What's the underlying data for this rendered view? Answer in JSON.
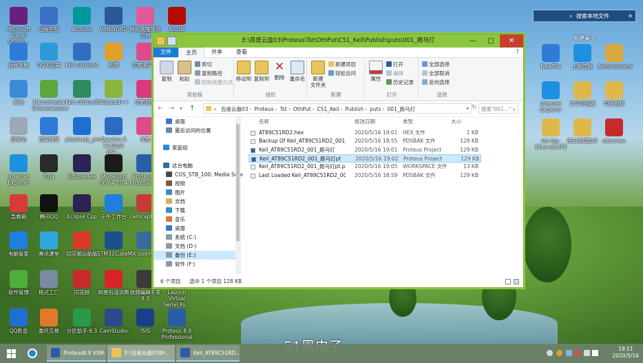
{
  "desktop_left_icons": [
    {
      "label": "Microsoft Visual Studio...",
      "icon": "visual-studio-icon",
      "color": "#68217a"
    },
    {
      "label": "远程控制",
      "icon": "remote-control-icon",
      "color": "#3a6fc4"
    },
    {
      "label": "Arduino",
      "icon": "arduino-icon",
      "color": "#00979c"
    },
    {
      "label": "WINWORD",
      "icon": "word-icon",
      "color": "#2b579a"
    },
    {
      "label": "网络唤醒服务工具",
      "icon": "wake-tool-icon",
      "color": "#e05a9a"
    },
    {
      "label": "Adobe Acro...",
      "icon": "acrobat-icon",
      "color": "#b30b00"
    },
    {
      "label": "远程电脑",
      "icon": "remote-pc-icon",
      "color": "#2f7bd6"
    },
    {
      "label": "QQ浏览器",
      "icon": "qq-browser-icon",
      "color": "#2e9ad9"
    },
    {
      "label": "Keil uVision4",
      "icon": "keil4-icon",
      "color": "#2f6fbf"
    },
    {
      "label": "画图",
      "icon": "paint-icon",
      "color": "#e0a02a"
    },
    {
      "label": "优酷客户端",
      "icon": "youku-icon",
      "color": "#e04a8a"
    },
    {
      "label": "网络",
      "icon": "network-icon",
      "color": "#3b8ad8"
    },
    {
      "label": "Macromedia Dreamweaver",
      "icon": "dreamweaver-icon",
      "color": "#5ca63c"
    },
    {
      "label": "Keil uVision5",
      "icon": "keil5-icon",
      "color": "#2f8a5f"
    },
    {
      "label": "Notepad++",
      "icon": "notepadpp-icon",
      "color": "#8ab43c"
    },
    {
      "label": "优酷视频",
      "icon": "youku-video-icon",
      "color": "#d83a7a"
    },
    {
      "label": "回收站",
      "icon": "recycle-bin-icon",
      "color": "#9aa8b8"
    },
    {
      "label": "百度网盘",
      "icon": "baidu-pan-icon",
      "color": "#2f7bd6"
    },
    {
      "label": "phpstudy_pro",
      "icon": "phpstudy-icon",
      "color": "#1e6fd0"
    },
    {
      "label": "Quartus II 13.0sp1 (64...",
      "icon": "quartus-icon",
      "color": "#2a6cc4"
    },
    {
      "label": "优酷",
      "icon": "youku2-icon",
      "color": "#e04a8a"
    },
    {
      "label": "Internet Explorer",
      "icon": "ie-icon",
      "color": "#1e90e0"
    },
    {
      "label": "Tina",
      "icon": "tina-icon",
      "color": "#2a2a2a"
    },
    {
      "label": "Eclipse Jee",
      "icon": "eclipse-jee-icon",
      "color": "#2c2255"
    },
    {
      "label": "Modelsim SE-64 10.4",
      "icon": "modelsim-icon",
      "color": "#1a1a1a"
    },
    {
      "label": "Proteus 8 Professional",
      "icon": "proteus-icon",
      "color": "#2a5ca8"
    },
    {
      "label": "急救箱",
      "icon": "rescue-icon",
      "color": "#d83a3a"
    },
    {
      "label": "腾讯QQ",
      "icon": "qq-icon",
      "color": "#111111"
    },
    {
      "label": "Eclipse Cpp",
      "icon": "eclipse-cpp-icon",
      "color": "#2c2255"
    },
    {
      "label": "千牛工作台",
      "icon": "qianniu-icon",
      "color": "#1e7fe0"
    },
    {
      "label": "camcapture",
      "icon": "camcapture-icon",
      "color": "#c83a3a"
    },
    {
      "label": "电脑管家",
      "icon": "pc-manager-icon",
      "color": "#1e7fe0"
    },
    {
      "label": "腾讯课堂",
      "icon": "tencent-class-icon",
      "color": "#2fa8e0"
    },
    {
      "label": "同花顺远航版",
      "icon": "tonghuashun-icon",
      "color": "#d83a2a"
    },
    {
      "label": "STM32CubeMX",
      "icon": "stm32cube-icon",
      "color": "#1a4f8a"
    },
    {
      "label": "zoom",
      "icon": "zoom-icon",
      "color": "#3a6a9a"
    },
    {
      "label": "软件管理",
      "icon": "software-manager-icon",
      "color": "#4caf3a"
    },
    {
      "label": "格式工厂",
      "icon": "format-factory-icon",
      "color": "#7a8aa0"
    },
    {
      "label": "同花顺",
      "icon": "tonghuashun2-icon",
      "color": "#c82a2a"
    },
    {
      "label": "网易有道词典",
      "icon": "youdao-icon",
      "color": "#d8222a"
    },
    {
      "label": "视频编辑专家 9.3",
      "icon": "video-editor-icon",
      "color": "#3a3a3a"
    },
    {
      "label": "Launch Virtual Serial Po...",
      "icon": "virtual-serial-icon",
      "color": "#6a6a6a"
    },
    {
      "label": "QQ影音",
      "icon": "qq-player-icon",
      "color": "#1e6fd0"
    },
    {
      "label": "委托交易",
      "icon": "trade-icon",
      "color": "#e07a2a"
    },
    {
      "label": "分区助手 6.3",
      "icon": "partition-icon",
      "color": "#2a9a4a"
    },
    {
      "label": "CamStudio",
      "icon": "camstudio-icon",
      "color": "#2a4a8a"
    },
    {
      "label": "ISIS",
      "icon": "isis-icon",
      "color": "#1a3f8a"
    },
    {
      "label": "Proteus 8.9 Professional",
      "icon": "proteus89-icon",
      "color": "#2a5ca8"
    }
  ],
  "desktop_right_icons": [
    {
      "label": "NewFile",
      "icon": "newfile-icon",
      "color": "#2f7bd6"
    },
    {
      "label": "上网导航",
      "icon": "ie-nav-icon",
      "color": "#1e90e0"
    },
    {
      "label": "Administrator",
      "icon": "user-folder-icon",
      "color": "#d9a83a"
    },
    {
      "label": "Internet Explorer",
      "icon": "ie2-icon",
      "color": "#1e90e0"
    },
    {
      "label": "文字识别器",
      "icon": "ocr-folder-icon",
      "color": "#e0b84a"
    },
    {
      "label": "中间视频",
      "icon": "video-folder-icon",
      "color": "#e0b84a"
    },
    {
      "label": "stc-isp-15xx-v6.87E",
      "icon": "stc-folder-icon",
      "color": "#e0b84a"
    },
    {
      "label": "串口调试助手",
      "icon": "serial-folder-icon",
      "color": "#e0b84a"
    },
    {
      "label": "sdccman",
      "icon": "pdf-icon",
      "color": "#c82a2a"
    }
  ],
  "right_panel": {
    "search_label": "搜索本地文件",
    "title": "新建桌子"
  },
  "explorer": {
    "title": "E:\\百度云盘03\\Proteus\\Tst\\OthPut\\C51_Keil\\Publish\\puts\\001_跑马灯",
    "window_controls": {
      "minimize": "—",
      "maximize": "□",
      "close": "✕"
    },
    "tabs": [
      "文件",
      "主页",
      "共享",
      "查看"
    ],
    "help": "?",
    "ribbon": {
      "clipboard": {
        "label": "剪贴板",
        "copy": "复制",
        "paste": "粘贴",
        "cut": "剪切",
        "copy_path": "复制路径",
        "paste_shortcut": "粘贴快捷方式"
      },
      "organize": {
        "label": "组织",
        "move_to": "移动到",
        "copy_to": "复制到",
        "delete": "删除",
        "rename": "重命名"
      },
      "new": {
        "label": "新建",
        "new_folder": "新建\n文件夹",
        "new_item": "新建项目",
        "easy_access": "轻松访问"
      },
      "open": {
        "label": "打开",
        "properties": "属性",
        "open": "打开",
        "edit": "编辑",
        "history": "历史记录"
      },
      "select": {
        "label": "选择",
        "select_all": "全部选择",
        "select_none": "全部取消",
        "invert": "反向选择"
      }
    },
    "address": {
      "segments": [
        "百度云盘03",
        "Proteus",
        "Tst",
        "OthPut",
        "C51_Keil",
        "Publish",
        "puts",
        "001_跑马灯"
      ],
      "search_placeholder": "搜索\"001...\""
    },
    "nav": {
      "back": "←",
      "forward": "→",
      "up": "↑",
      "prefix": "«",
      "refresh": "↻"
    },
    "nav_items": [
      {
        "label": "桌面",
        "icon": "desktop-icon",
        "color": "#3a78c4"
      },
      {
        "label": "最近访问的位置",
        "icon": "recent-icon",
        "color": "#6a8aaa"
      },
      {
        "label": "家庭组",
        "icon": "homegroup-icon",
        "color": "#2a8ad8"
      },
      {
        "label": "这台电脑",
        "icon": "this-pc-icon",
        "color": "#3a6aa8"
      },
      {
        "label": "COS_STB_100: Media Serv",
        "icon": "media-server-icon",
        "color": "#4a4a4a"
      },
      {
        "label": "视频",
        "icon": "videos-folder-icon",
        "color": "#7a5a3a"
      },
      {
        "label": "图片",
        "icon": "pictures-folder-icon",
        "color": "#3a8ac8"
      },
      {
        "label": "文档",
        "icon": "documents-folder-icon",
        "color": "#d9b050"
      },
      {
        "label": "下载",
        "icon": "downloads-folder-icon",
        "color": "#3a8ac8"
      },
      {
        "label": "音乐",
        "icon": "music-folder-icon",
        "color": "#d97a3a"
      },
      {
        "label": "桌面",
        "icon": "desktop2-icon",
        "color": "#3a78c4"
      },
      {
        "label": "系统 (C:)",
        "icon": "drive-c-icon",
        "color": "#8a9aaa"
      },
      {
        "label": "文档 (D:)",
        "icon": "drive-d-icon",
        "color": "#8a9aaa"
      },
      {
        "label": "备份 (E:)",
        "icon": "drive-e-icon",
        "color": "#8a9aaa"
      },
      {
        "label": "软件 (F:)",
        "icon": "drive-f-icon",
        "color": "#8a9aaa"
      }
    ],
    "columns": {
      "name": "名称",
      "date": "修改日期",
      "type": "类型",
      "size": "大小"
    },
    "files": [
      {
        "name": "AT89C51RD2.hex",
        "date": "2020/5/16 19:01",
        "type": "HEX 文件",
        "size": "1 KB",
        "icon": "hex-file-icon"
      },
      {
        "name": "Backup Of Keil_AT89C51RD2_001_跑...",
        "date": "2020/5/16 18:55",
        "type": "PDSBAK 文件",
        "size": "128 KB",
        "icon": "bak-file-icon"
      },
      {
        "name": "Keil_AT89C51RD2_001_跑马灯",
        "date": "2020/5/16 19:01",
        "type": "Proteus Project",
        "size": "129 KB",
        "icon": "proteus-project-icon"
      },
      {
        "name": "Keil_AT89C51RD2_001_跑马灯pt",
        "date": "2020/5/16 19:02",
        "type": "Proteus Project",
        "size": "129 KB",
        "icon": "proteus-project-icon"
      },
      {
        "name": "Keil_AT89C51RD2_001_跑马灯pt.pdsp...",
        "date": "2020/5/16 19:05",
        "type": "WORKSPACE 文件",
        "size": "13 KB",
        "icon": "workspace-file-icon"
      },
      {
        "name": "Last Loaded Keil_AT89C51RD2_001_...",
        "date": "2020/5/16 18:59",
        "type": "PDSBAK 文件",
        "size": "129 KB",
        "icon": "bak-file-icon"
      }
    ],
    "selected_file_index": 3,
    "status": {
      "count": "6 个项目",
      "selected": "选中 1 个项目  128 KB"
    }
  },
  "taskbar": {
    "search_icon": "search-icon",
    "tasks": [
      {
        "label": "Proteus8.9 VSM...",
        "icon": "proteus-task-icon",
        "color": "#2a5ca8"
      },
      {
        "label": "E:\\百度云盘03\\Pr...",
        "icon": "explorer-task-icon",
        "color": "#e8c45a"
      },
      {
        "label": "Keil_AT89C51RD...",
        "icon": "keil-task-icon",
        "color": "#2a5ca8"
      }
    ],
    "time": "19:11",
    "date": "2020/5/16"
  },
  "watermark": "51黑电子"
}
